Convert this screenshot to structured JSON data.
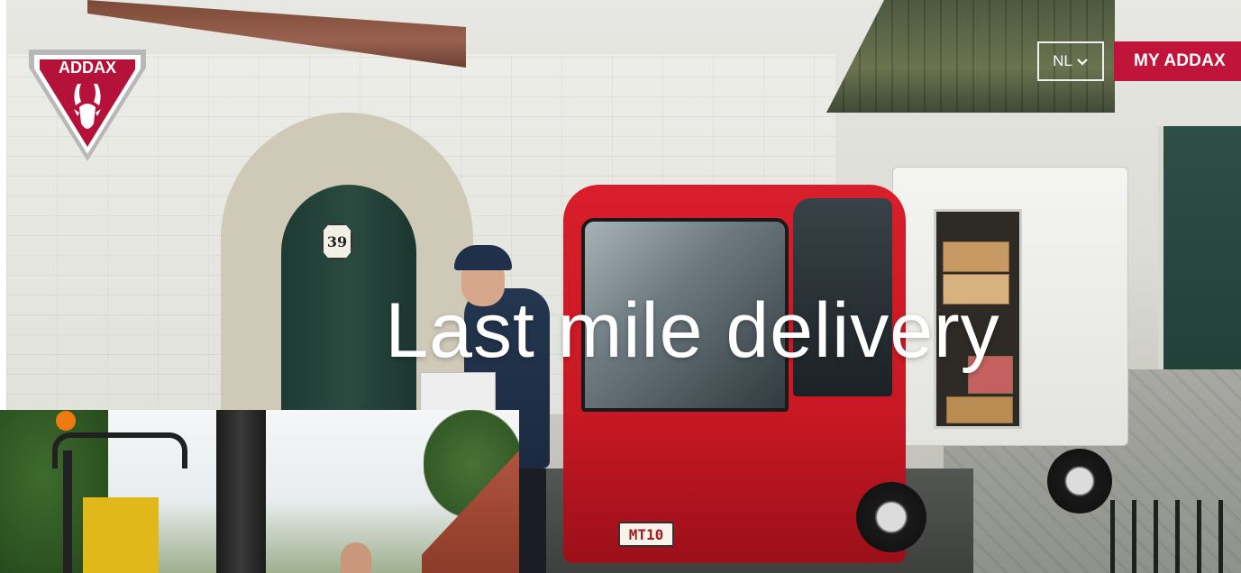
{
  "brand": {
    "logo_text": "ADDAX",
    "logo_icon": "antelope-shield-icon",
    "accent_color": "#c1143a"
  },
  "header": {
    "language": {
      "selected": "NL",
      "icon": "chevron-down-icon"
    },
    "account_button": "MY ADDAX"
  },
  "hero": {
    "headline": "Last mile delivery",
    "house_number": "39",
    "vehicle_plate": "MT10"
  }
}
